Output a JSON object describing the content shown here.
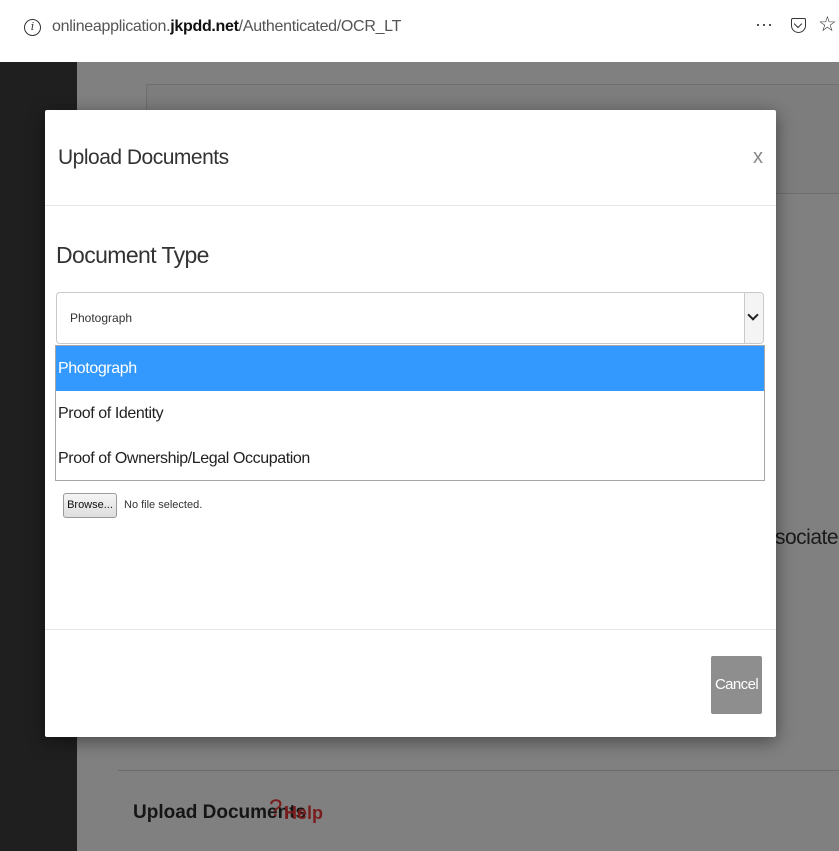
{
  "browser": {
    "url_prefix": "onlineapplication.",
    "url_domain": "jkpdd.net",
    "url_path": "/Authenticated/OCR_LT",
    "page_actions": "···"
  },
  "background_page": {
    "partial_text": "sociated",
    "section_title": "Upload Documents",
    "help_mark": "?",
    "help_label": "Help"
  },
  "modal": {
    "title": "Upload Documents",
    "close_glyph": "x",
    "field_label": "Document Type",
    "select": {
      "value": "Photograph",
      "options": [
        "Photograph",
        "Proof of Identity",
        "Proof of Ownership/Legal Occupation"
      ],
      "highlighted_index": 0
    },
    "file_input": {
      "button_label": "Browse...",
      "status": "No file selected."
    },
    "footer": {
      "cancel_label": "Cancel"
    }
  },
  "colors": {
    "overlay_bg": "#7f7f7f",
    "highlight": "#3399ff",
    "help_red": "#7a1c1c",
    "cancel_bg": "#8e8e8e"
  }
}
